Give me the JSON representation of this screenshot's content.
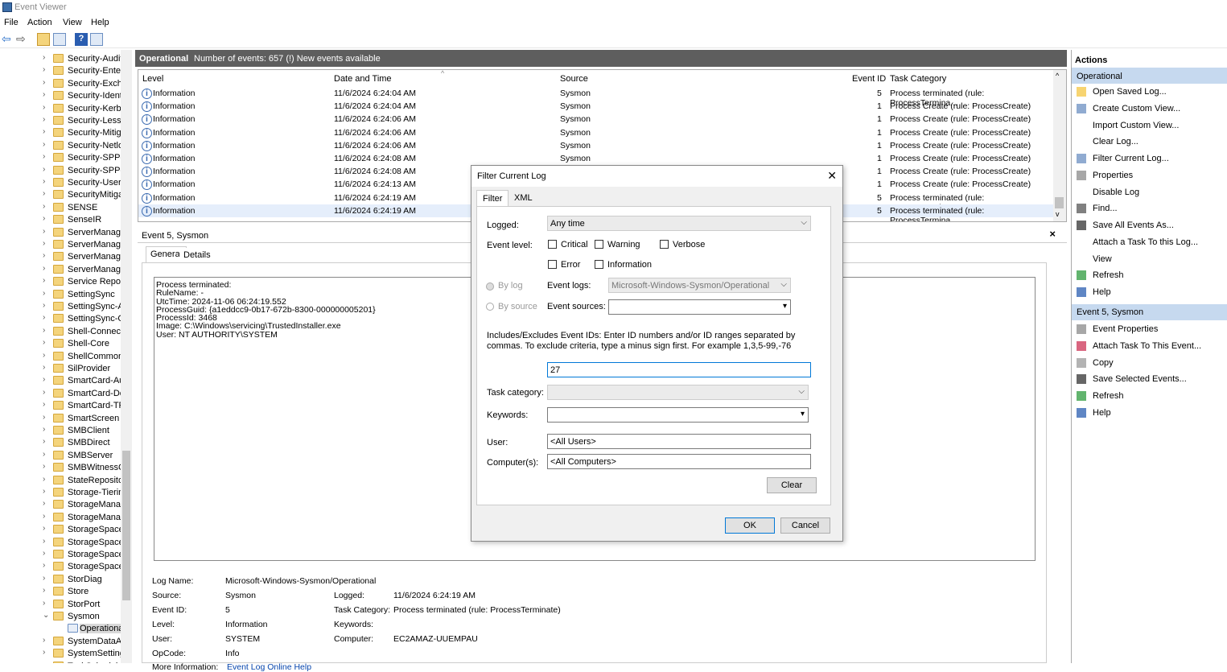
{
  "window": {
    "title": "Event Viewer"
  },
  "menu": [
    "File",
    "Action",
    "View",
    "Help"
  ],
  "tree": {
    "items": [
      "Security-Audit",
      "Security-Enter",
      "Security-Excha",
      "Security-Identi",
      "Security-Kerbe",
      "Security-LessP",
      "Security-Mitig",
      "Security-Netlo",
      "Security-SPP-U",
      "Security-SPP-U",
      "Security-UserC",
      "SecurityMitiga",
      "SENSE",
      "SenseIR",
      "ServerManage",
      "ServerManage",
      "ServerManage",
      "ServerManage",
      "Service Report",
      "SettingSync",
      "SettingSync-A",
      "SettingSync-O",
      "Shell-Connect",
      "Shell-Core",
      "ShellCommon",
      "SilProvider",
      "SmartCard-Au",
      "SmartCard-De",
      "SmartCard-TP",
      "SmartScreen",
      "SMBClient",
      "SMBDirect",
      "SMBServer",
      "SMBWitnessCl",
      "StateRepositor",
      "Storage-Tierin",
      "StorageManag",
      "StorageManag",
      "StorageSpaces",
      "StorageSpaces",
      "StorageSpaces",
      "StorageSpaces",
      "StorDiag",
      "Store",
      "StorPort",
      "Sysmon",
      "Operationa",
      "SystemDataAr",
      "SystemSetting",
      "TaskScheduler"
    ]
  },
  "log_header": {
    "name": "Operational",
    "count_text": "Number of events: 657 (!) New events available"
  },
  "grid": {
    "columns": [
      "Level",
      "Date and Time",
      "Source",
      "Event ID",
      "Task Category"
    ],
    "rows": [
      [
        "Information",
        "11/6/2024 6:24:04 AM",
        "Sysmon",
        "5",
        "Process terminated (rule: ProcessTermina..."
      ],
      [
        "Information",
        "11/6/2024 6:24:04 AM",
        "Sysmon",
        "1",
        "Process Create (rule: ProcessCreate)"
      ],
      [
        "Information",
        "11/6/2024 6:24:06 AM",
        "Sysmon",
        "1",
        "Process Create (rule: ProcessCreate)"
      ],
      [
        "Information",
        "11/6/2024 6:24:06 AM",
        "Sysmon",
        "1",
        "Process Create (rule: ProcessCreate)"
      ],
      [
        "Information",
        "11/6/2024 6:24:06 AM",
        "Sysmon",
        "1",
        "Process Create (rule: ProcessCreate)"
      ],
      [
        "Information",
        "11/6/2024 6:24:08 AM",
        "Sysmon",
        "1",
        "Process Create (rule: ProcessCreate)"
      ],
      [
        "Information",
        "11/6/2024 6:24:08 AM",
        "Sysmon",
        "1",
        "Process Create (rule: ProcessCreate)"
      ],
      [
        "Information",
        "11/6/2024 6:24:13 AM",
        "Sysmon",
        "1",
        "Process Create (rule: ProcessCreate)"
      ],
      [
        "Information",
        "11/6/2024 6:24:19 AM",
        "Sysmon",
        "5",
        "Process terminated (rule: ProcessTermina..."
      ],
      [
        "Information",
        "11/6/2024 6:24:19 AM",
        "Sysmon",
        "5",
        "Process terminated (rule: ProcessTermina..."
      ]
    ]
  },
  "detail": {
    "title": "Event 5, Sysmon",
    "tabs": [
      "General",
      "Details"
    ],
    "message": [
      "Process terminated:",
      "RuleName: -",
      "UtcTime: 2024-11-06 06:24:19.552",
      "ProcessGuid: {a1eddcc9-0b17-672b-8300-000000005201}",
      "ProcessId: 3468",
      "Image: C:\\Windows\\servicing\\TrustedInstaller.exe",
      "User: NT AUTHORITY\\SYSTEM"
    ],
    "props": {
      "log_name_label": "Log Name:",
      "log_name": "Microsoft-Windows-Sysmon/Operational",
      "source_label": "Source:",
      "source": "Sysmon",
      "logged_label": "Logged:",
      "logged": "11/6/2024 6:24:19 AM",
      "event_id_label": "Event ID:",
      "event_id": "5",
      "task_label": "Task Category:",
      "task": "Process terminated (rule: ProcessTerminate)",
      "level_label": "Level:",
      "level": "Information",
      "keywords_label": "Keywords:",
      "keywords": "",
      "user_label": "User:",
      "user": "SYSTEM",
      "computer_label": "Computer:",
      "computer": "EC2AMAZ-UUEMPAU",
      "opcode_label": "OpCode:",
      "opcode": "Info",
      "more_label": "More Information:",
      "more_link": "Event Log Online Help"
    }
  },
  "actions": {
    "title": "Actions",
    "section1": "Operational",
    "items1": [
      "Open Saved Log...",
      "Create Custom View...",
      "Import Custom View...",
      "Clear Log...",
      "Filter Current Log...",
      "Properties",
      "Disable Log",
      "Find...",
      "Save All Events As...",
      "Attach a Task To this Log...",
      "View",
      "Refresh",
      "Help"
    ],
    "section2": "Event 5, Sysmon",
    "items2": [
      "Event Properties",
      "Attach Task To This Event...",
      "Copy",
      "Save Selected Events...",
      "Refresh",
      "Help"
    ]
  },
  "dialog": {
    "title": "Filter Current Log",
    "tabs": [
      "Filter",
      "XML"
    ],
    "logged_label": "Logged:",
    "logged_value": "Any time",
    "event_level_label": "Event level:",
    "levels": [
      "Critical",
      "Warning",
      "Verbose",
      "Error",
      "Information"
    ],
    "by_log": "By log",
    "event_logs_label": "Event logs:",
    "event_logs_value": "Microsoft-Windows-Sysmon/Operational",
    "by_source": "By source",
    "event_sources_label": "Event sources:",
    "includes_text": "Includes/Excludes Event IDs: Enter ID numbers and/or ID ranges separated by commas. To exclude criteria, type a minus sign first. For example 1,3,5-99,-76",
    "event_ids_value": "27",
    "task_category_label": "Task category:",
    "keywords_label": "Keywords:",
    "user_label": "User:",
    "user_value": "<All Users>",
    "computers_label": "Computer(s):",
    "computers_value": "<All Computers>",
    "clear_btn": "Clear",
    "ok_btn": "OK",
    "cancel_btn": "Cancel"
  }
}
